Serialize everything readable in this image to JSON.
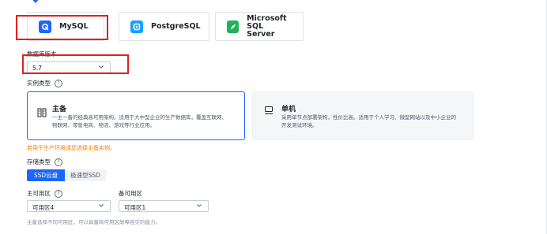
{
  "engines": [
    {
      "label": "MySQL",
      "color": "#1a66ff",
      "icon": "mysql-icon"
    },
    {
      "label": "PostgreSQL",
      "color": "#1a66ff",
      "icon": "postgresql-icon"
    },
    {
      "label": "Microsoft SQL Server",
      "line1": "Microsoft SQL",
      "line2": "Server",
      "color": "#21b15b",
      "icon": "sqlserver-icon"
    }
  ],
  "version": {
    "label": "数据库版本",
    "value": "5.7"
  },
  "instance_type": {
    "label": "实例类型",
    "options": [
      {
        "title": "主备",
        "desc_line1": "一主一备的经典高可用架构。适用于大中型企业的生产数据库，覆盖互联网、",
        "desc_line2": "物联网、零售电商、物流、游戏等行业应用。",
        "icon": "primary-standby-icon"
      },
      {
        "title": "单机",
        "desc_line1": "采用单节点部署架构，性价比高。适用于个人学习、微型网站以及中小企业的",
        "desc_line2": "开发测试环境。",
        "icon": "single-server-icon"
      }
    ],
    "hint": "若用于生产环境请您选择主备实例。"
  },
  "storage": {
    "label": "存储类型",
    "options": [
      "SSD云盘",
      "极速型SSD"
    ],
    "selected": "SSD云盘"
  },
  "zones": {
    "primary_label": "主可用区",
    "primary_value": "可用区4",
    "standby_label": "备可用区",
    "standby_value": "可用区1",
    "note": "主备选择不同可用区，可以具备跨可用区故障容灾的能力。"
  },
  "accent_color": "#1a66ff",
  "warning_color": "#ff7d00"
}
